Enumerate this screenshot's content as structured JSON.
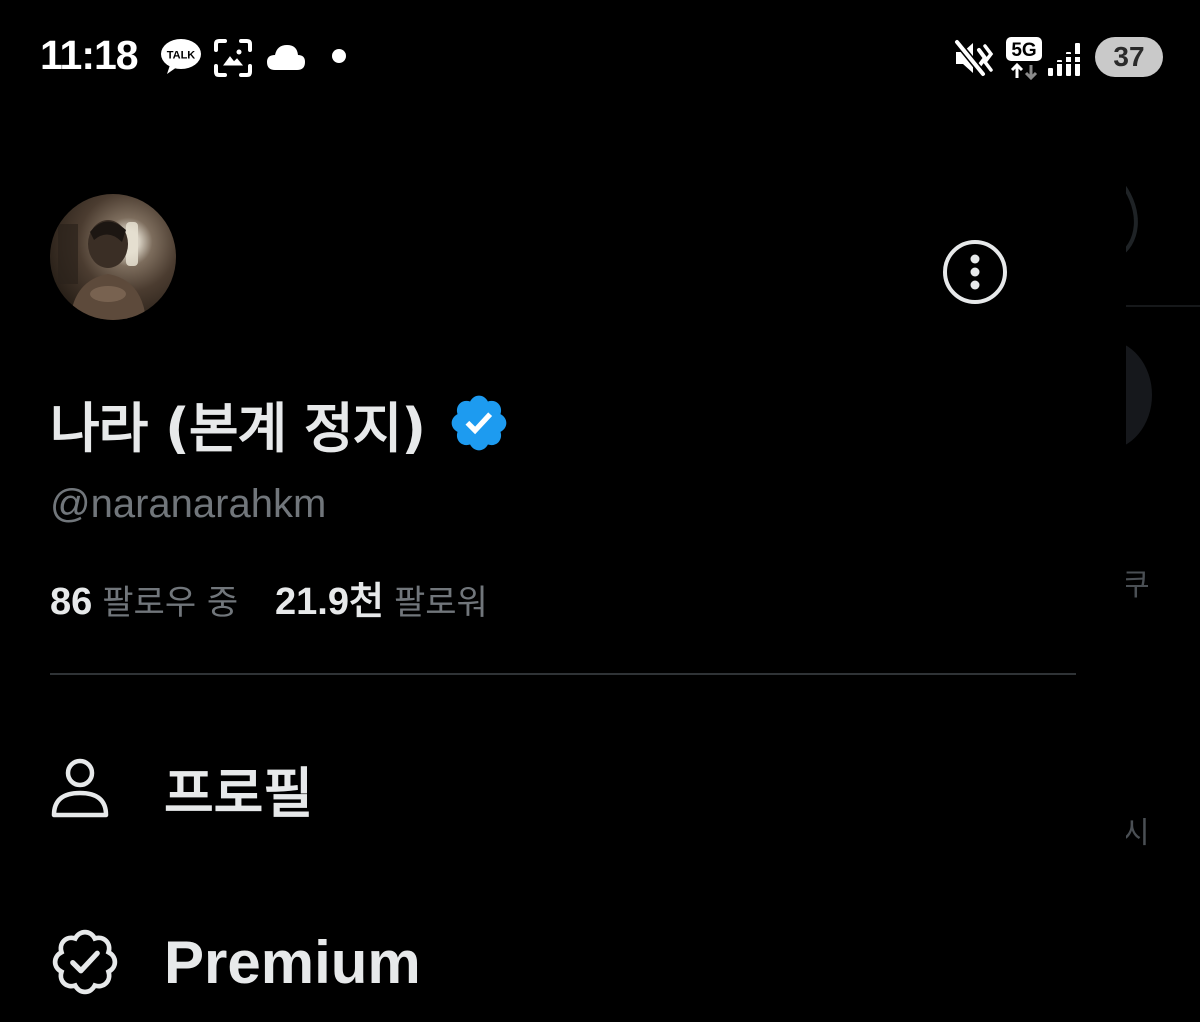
{
  "status_bar": {
    "time": "11:18",
    "kakao_label": "TALK",
    "network_label": "5G",
    "battery": "37",
    "icons": [
      "kakaotalk-icon",
      "screen-capture-icon",
      "cloud-icon",
      "notification-dot-icon",
      "vibrate-mute-icon",
      "network-5g-icon",
      "signal-icon",
      "battery-icon"
    ]
  },
  "profile": {
    "display_name": "나라 (본계 정지)",
    "handle": "@naranarahkm",
    "following_count": "86",
    "following_label": "팔로우 중",
    "followers_count": "21.9천",
    "followers_label": "팔로워"
  },
  "menu": {
    "items": [
      {
        "label": "프로필",
        "icon": "person-icon"
      },
      {
        "label": "Premium",
        "icon": "verified-badge-icon"
      }
    ]
  },
  "background": {
    "text_1": "쿠",
    "text_2": "시"
  },
  "colors": {
    "background": "#000000",
    "text": "#e7e9ea",
    "muted": "#71767b",
    "verified": "#1d9bf0",
    "divider": "#2f3336"
  }
}
